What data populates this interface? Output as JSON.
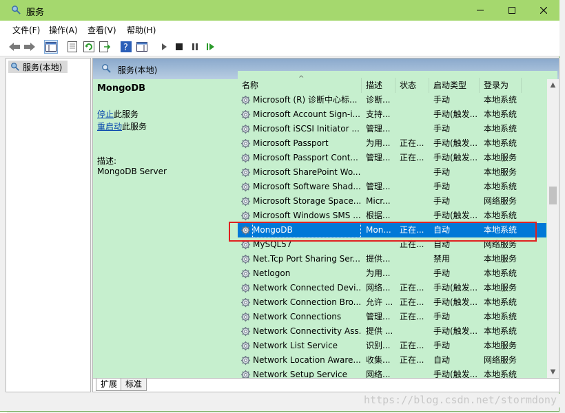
{
  "window": {
    "title": "服务",
    "icon": "gear-magnifier-icon"
  },
  "menu": [
    "文件(F)",
    "操作(A)",
    "查看(V)",
    "帮助(H)"
  ],
  "tree": {
    "item": "服务(本地)"
  },
  "content": {
    "header": "服务(本地)",
    "service_title": "MongoDB",
    "stop_link": "停止",
    "stop_suffix": "此服务",
    "restart_link": "重启动",
    "restart_suffix": "此服务",
    "desc_label": "描述:",
    "desc_value": "MongoDB Server"
  },
  "columns": [
    "名称",
    "描述",
    "状态",
    "启动类型",
    "登录为"
  ],
  "rows": [
    {
      "name": "Microsoft (R) 诊断中心标...",
      "desc": "诊断...",
      "status": "",
      "startup": "手动",
      "logon": "本地系统"
    },
    {
      "name": "Microsoft Account Sign-i...",
      "desc": "支持...",
      "status": "",
      "startup": "手动(触发...",
      "logon": "本地系统"
    },
    {
      "name": "Microsoft iSCSI Initiator ...",
      "desc": "管理...",
      "status": "",
      "startup": "手动",
      "logon": "本地系统"
    },
    {
      "name": "Microsoft Passport",
      "desc": "为用...",
      "status": "正在...",
      "startup": "手动(触发...",
      "logon": "本地系统"
    },
    {
      "name": "Microsoft Passport Cont...",
      "desc": "管理...",
      "status": "正在...",
      "startup": "手动(触发...",
      "logon": "本地服务"
    },
    {
      "name": "Microsoft SharePoint Wo...",
      "desc": "",
      "status": "",
      "startup": "手动",
      "logon": "本地服务"
    },
    {
      "name": "Microsoft Software Shad...",
      "desc": "管理...",
      "status": "",
      "startup": "手动",
      "logon": "本地系统"
    },
    {
      "name": "Microsoft Storage Space...",
      "desc": "Micr...",
      "status": "",
      "startup": "手动",
      "logon": "网络服务"
    },
    {
      "name": "Microsoft Windows SMS ...",
      "desc": "根据...",
      "status": "",
      "startup": "手动(触发...",
      "logon": "本地系统"
    },
    {
      "name": "MongoDB",
      "desc": "Mon...",
      "status": "正在...",
      "startup": "自动",
      "logon": "本地系统",
      "selected": true
    },
    {
      "name": "MySQL57",
      "desc": "",
      "status": "正在...",
      "startup": "自动",
      "logon": "网络服务"
    },
    {
      "name": "Net.Tcp Port Sharing Ser...",
      "desc": "提供...",
      "status": "",
      "startup": "禁用",
      "logon": "本地服务"
    },
    {
      "name": "Netlogon",
      "desc": "为用...",
      "status": "",
      "startup": "手动",
      "logon": "本地系统"
    },
    {
      "name": "Network Connected Devi...",
      "desc": "网络...",
      "status": "正在...",
      "startup": "手动(触发...",
      "logon": "本地服务"
    },
    {
      "name": "Network Connection Bro...",
      "desc": "允许 ...",
      "status": "正在...",
      "startup": "手动(触发...",
      "logon": "本地系统"
    },
    {
      "name": "Network Connections",
      "desc": "管理...",
      "status": "正在...",
      "startup": "手动",
      "logon": "本地系统"
    },
    {
      "name": "Network Connectivity Ass...",
      "desc": "提供 ...",
      "status": "",
      "startup": "手动(触发...",
      "logon": "本地系统"
    },
    {
      "name": "Network List Service",
      "desc": "识别...",
      "status": "正在...",
      "startup": "手动",
      "logon": "本地服务"
    },
    {
      "name": "Network Location Aware...",
      "desc": "收集...",
      "status": "正在...",
      "startup": "自动",
      "logon": "网络服务"
    },
    {
      "name": "Network Setup Service",
      "desc": "网络...",
      "status": "",
      "startup": "手动(触发...",
      "logon": "本地系统"
    }
  ],
  "tabs": [
    "扩展",
    "标准"
  ],
  "watermark": "https://blog.csdn.net/stormdony",
  "colors": {
    "titlebar": "#a5d86e",
    "panel": "#c6efce",
    "selection": "#0078d7",
    "highlight_box": "#e02020"
  }
}
